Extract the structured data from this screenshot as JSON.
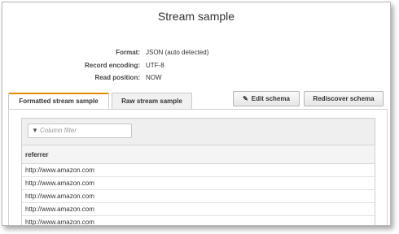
{
  "title": "Stream sample",
  "details": [
    {
      "key": "Format:",
      "value": "JSON (auto detected)"
    },
    {
      "key": "Record encoding:",
      "value": "UTF-8"
    },
    {
      "key": "Read position:",
      "value": "NOW"
    }
  ],
  "tabs": [
    {
      "label": "Formatted stream sample",
      "active": true
    },
    {
      "label": "Raw stream sample",
      "active": false
    }
  ],
  "buttons": {
    "edit_schema": "Edit schema",
    "rediscover_schema": "Rediscover schema"
  },
  "filter": {
    "placeholder": "Column filter"
  },
  "table": {
    "column": "referrer",
    "rows": [
      "http://www.amazon.com",
      "http://www.amazon.com",
      "http://www.amazon.com",
      "http://www.amazon.com",
      "http://www.amazon.com"
    ]
  },
  "colors": {
    "active_tab_accent": "#e58a00"
  }
}
